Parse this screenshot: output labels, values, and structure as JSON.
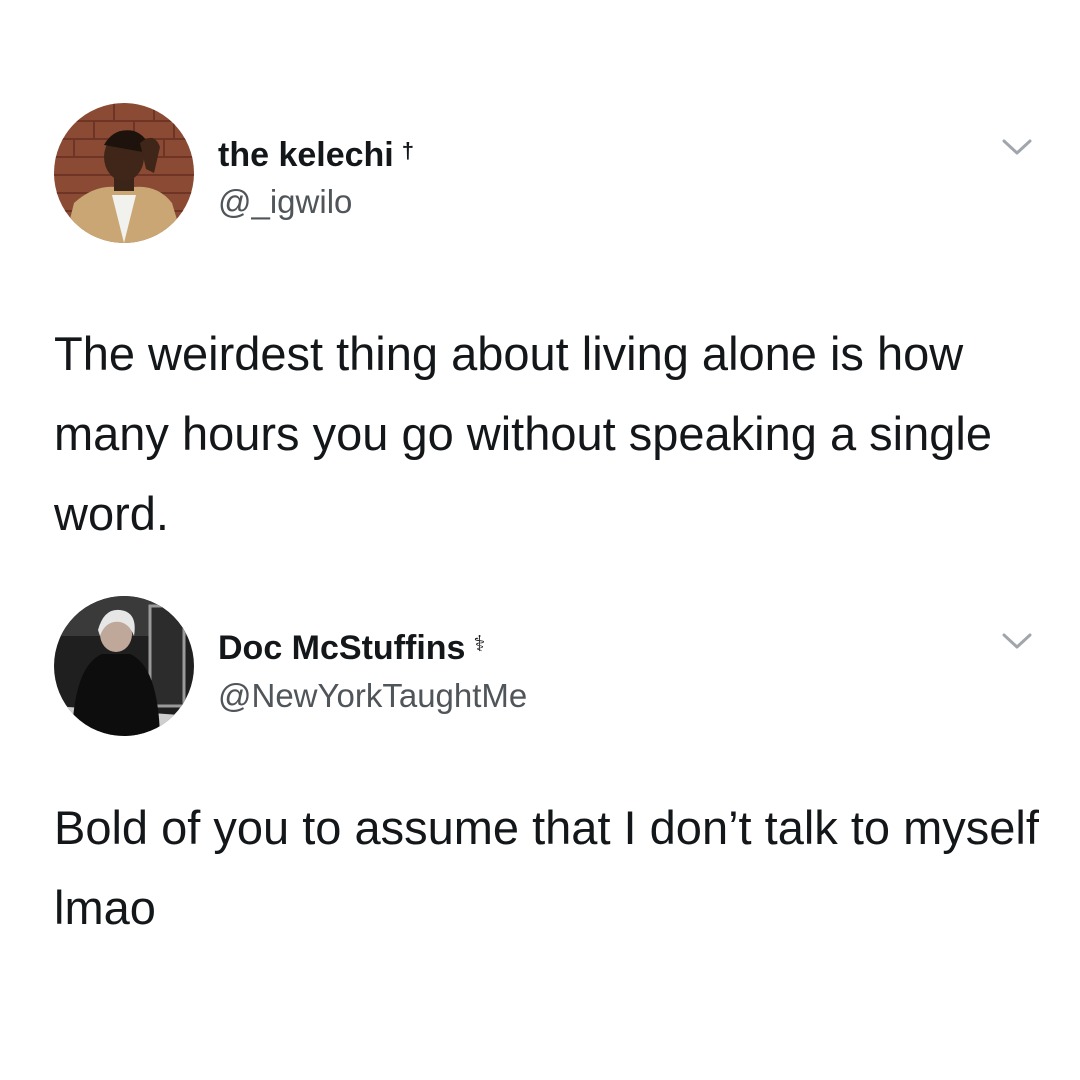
{
  "tweets": [
    {
      "display_name": "the kelechi",
      "name_glyph": "†",
      "handle": "@_igwilo",
      "text": "The weirdest thing about living alone is how many hours you go without speaking a single word."
    },
    {
      "display_name": "Doc McStuffins",
      "name_glyph": "⚕",
      "handle": "@NewYorkTaughtMe",
      "text": "Bold of you to assume that I don’t talk to myself lmao"
    }
  ],
  "icons": {
    "menu": "chevron-down-icon"
  },
  "colors": {
    "background": "#ffffff",
    "text": "#14171a",
    "secondary_text": "#50555a",
    "chevron": "#a0a6ab"
  }
}
